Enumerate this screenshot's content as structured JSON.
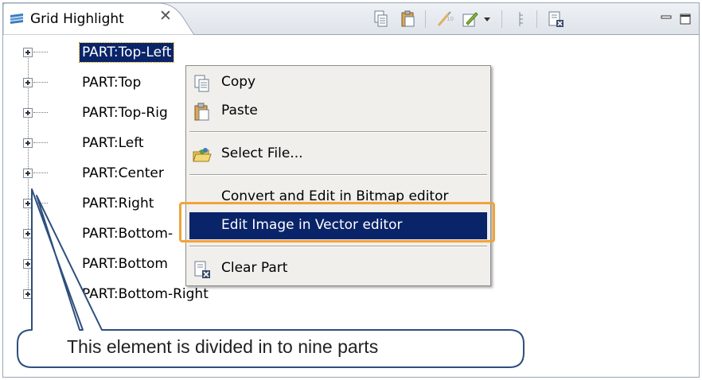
{
  "tab": {
    "title": "Grid Highlight",
    "close_glyph": "✕"
  },
  "toolbar": {
    "icons": [
      "copy-icon",
      "paste-icon",
      "convert-bitmap-icon",
      "edit-vector-icon",
      "dropdown-arrow-icon",
      "grid-icon",
      "clear-part-icon",
      "minimize-icon",
      "maximize-icon"
    ]
  },
  "tree": {
    "items": [
      {
        "label": "PART:Top-Left",
        "selected": true
      },
      {
        "label": "PART:Top"
      },
      {
        "label": "PART:Top-Rig"
      },
      {
        "label": "PART:Left"
      },
      {
        "label": "PART:Center"
      },
      {
        "label": "PART:Right"
      },
      {
        "label": "PART:Bottom-"
      },
      {
        "label": "PART:Bottom"
      },
      {
        "label": "PART:Bottom-Right"
      }
    ]
  },
  "context_menu": {
    "copy": "Copy",
    "paste": "Paste",
    "select_file": "Select File...",
    "convert_bitmap": "Convert and Edit in Bitmap editor",
    "edit_vector": "Edit Image in Vector editor",
    "clear_part": "Clear Part"
  },
  "callout": {
    "text": "This element is divided in to nine parts"
  },
  "colors": {
    "selection": "#0a2469",
    "highlight_border": "#f2a33a",
    "callout_stroke": "#2d4f7c"
  }
}
